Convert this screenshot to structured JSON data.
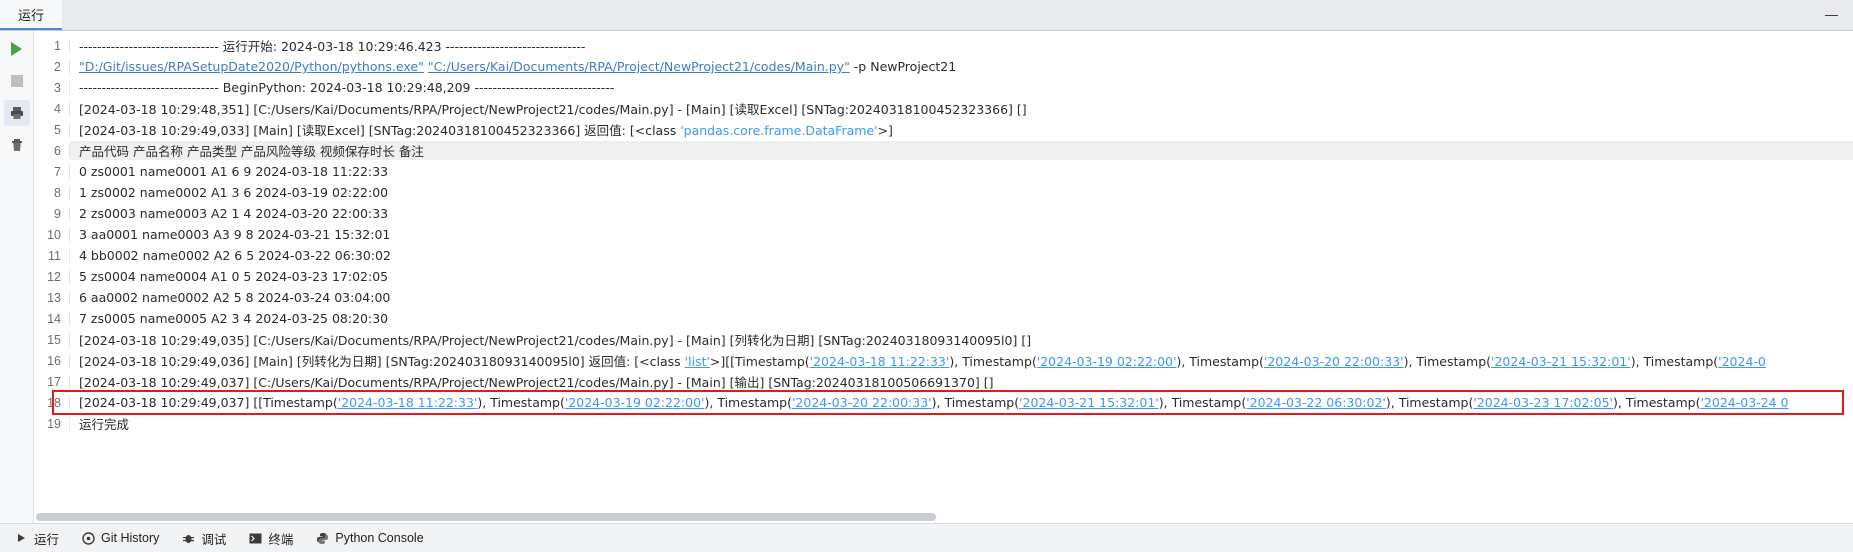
{
  "window": {
    "tab_label": "运行",
    "minimize_label": "—"
  },
  "side_toolbar": {
    "items": [
      {
        "name": "run-button",
        "icon": "play-icon",
        "tooltip": "运行"
      },
      {
        "name": "stop-button",
        "icon": "stop-icon",
        "tooltip": "停止"
      },
      {
        "name": "print-button",
        "icon": "printer-icon",
        "tooltip": "打印"
      },
      {
        "name": "clear-button",
        "icon": "trash-icon",
        "tooltip": "清空"
      }
    ]
  },
  "console": {
    "lines": [
      {
        "num": "1",
        "segments": [
          {
            "t": "------------------------------- 运行开始: 2024-03-18 10:29:46.423 -------------------------------",
            "s": "plain"
          }
        ]
      },
      {
        "num": "2",
        "segments": [
          {
            "t": "\"D:/Git/issues/RPASetupDate2020/Python/pythons.exe\"",
            "s": "link"
          },
          {
            "t": "    ",
            "s": "plain"
          },
          {
            "t": "\"C:/Users/Kai/Documents/RPA/Project/NewProject21/codes/Main.py\"",
            "s": "link"
          },
          {
            "t": "  -p  NewProject21",
            "s": "plain"
          }
        ]
      },
      {
        "num": "3",
        "segments": [
          {
            "t": "------------------------------- BeginPython: 2024-03-18 10:29:48,209 -------------------------------",
            "s": "plain"
          }
        ]
      },
      {
        "num": "4",
        "segments": [
          {
            "t": "[2024-03-18 10:29:48,351] [C:/Users/Kai/Documents/RPA/Project/NewProject21/codes/Main.py] - [Main] [读取Excel] [SNTag:20240318100452323366] []",
            "s": "plain"
          }
        ]
      },
      {
        "num": "5",
        "segments": [
          {
            "t": "[2024-03-18 10:29:49,033] [Main] [读取Excel] [SNTag:20240318100452323366]  返回值: [<class ",
            "s": "plain"
          },
          {
            "t": "'pandas.core.frame.DataFrame'",
            "s": "df"
          },
          {
            "t": ">]",
            "s": "plain"
          }
        ]
      },
      {
        "num": "6",
        "header": true,
        "segments": [
          {
            "t": "  产品代码    产品名称 产品类型 产品风险等级 视频保存时长              备注",
            "s": "plain"
          }
        ]
      },
      {
        "num": "7",
        "segments": [
          {
            "t": "0  zs0001  name0001   A1     6     9 2024-03-18 11:22:33",
            "s": "plain"
          }
        ]
      },
      {
        "num": "8",
        "segments": [
          {
            "t": "1  zs0002  name0002   A1     3     6 2024-03-19 02:22:00",
            "s": "plain"
          }
        ]
      },
      {
        "num": "9",
        "segments": [
          {
            "t": "2  zs0003  name0003   A2     1     4 2024-03-20 22:00:33",
            "s": "plain"
          }
        ]
      },
      {
        "num": "10",
        "segments": [
          {
            "t": "3  aa0001  name0003   A3     9      8 2024-03-21 15:32:01",
            "s": "plain"
          }
        ]
      },
      {
        "num": "11",
        "segments": [
          {
            "t": "4  bb0002  name0002   A2     6      5 2024-03-22 06:30:02",
            "s": "plain"
          }
        ]
      },
      {
        "num": "12",
        "segments": [
          {
            "t": "5  zs0004  name0004   A1     0      5 2024-03-23 17:02:05",
            "s": "plain"
          }
        ]
      },
      {
        "num": "13",
        "segments": [
          {
            "t": "6  aa0002  name0002   A2     5      8 2024-03-24 03:04:00",
            "s": "plain"
          }
        ]
      },
      {
        "num": "14",
        "segments": [
          {
            "t": "7  zs0005  name0005   A2     3      4 2024-03-25 08:20:30",
            "s": "plain"
          }
        ]
      },
      {
        "num": "15",
        "segments": [
          {
            "t": "[2024-03-18 10:29:49,035] [C:/Users/Kai/Documents/RPA/Project/NewProject21/codes/Main.py] - [Main] [列转化为日期] [SNTag:20240318093140095l0] []",
            "s": "plain"
          }
        ]
      },
      {
        "num": "16",
        "segments": [
          {
            "t": "[2024-03-18 10:29:49,036] [Main] [列转化为日期] [SNTag:20240318093140095l0]  返回值: [<class ",
            "s": "plain"
          },
          {
            "t": "'list'",
            "s": "ts"
          },
          {
            "t": ">][[Timestamp(",
            "s": "plain"
          },
          {
            "t": "'2024-03-18 11:22:33'",
            "s": "ts"
          },
          {
            "t": "), Timestamp(",
            "s": "plain"
          },
          {
            "t": "'2024-03-19 02:22:00'",
            "s": "ts"
          },
          {
            "t": "), Timestamp(",
            "s": "plain"
          },
          {
            "t": "'2024-03-20 22:00:33'",
            "s": "ts"
          },
          {
            "t": "), Timestamp(",
            "s": "plain"
          },
          {
            "t": "'2024-03-21 15:32:01'",
            "s": "ts"
          },
          {
            "t": "), Timestamp(",
            "s": "plain"
          },
          {
            "t": "'2024-0",
            "s": "ts"
          }
        ]
      },
      {
        "num": "17",
        "segments": [
          {
            "t": "[2024-03-18 10:29:49,037] [C:/Users/Kai/Documents/RPA/Project/NewProject21/codes/Main.py] - [Main] [输出] [SNTag:20240318100506691370] []",
            "s": "plain"
          }
        ]
      },
      {
        "num": "18",
        "highlighted": true,
        "segments": [
          {
            "t": "[2024-03-18 10:29:49,037] [[Timestamp(",
            "s": "plain"
          },
          {
            "t": "'2024-03-18 11:22:33'",
            "s": "ts"
          },
          {
            "t": "), Timestamp(",
            "s": "plain"
          },
          {
            "t": "'2024-03-19 02:22:00'",
            "s": "ts"
          },
          {
            "t": "), Timestamp(",
            "s": "plain"
          },
          {
            "t": "'2024-03-20 22:00:33'",
            "s": "ts"
          },
          {
            "t": "), Timestamp(",
            "s": "plain"
          },
          {
            "t": "'2024-03-21 15:32:01'",
            "s": "ts"
          },
          {
            "t": "), Timestamp(",
            "s": "plain"
          },
          {
            "t": "'2024-03-22 06:30:02'",
            "s": "ts"
          },
          {
            "t": "), Timestamp(",
            "s": "plain"
          },
          {
            "t": "'2024-03-23 17:02:05'",
            "s": "ts"
          },
          {
            "t": "), Timestamp(",
            "s": "plain"
          },
          {
            "t": "'2024-03-24 0",
            "s": "ts"
          }
        ]
      },
      {
        "num": "19",
        "segments": [
          {
            "t": "运行完成",
            "s": "plain"
          }
        ]
      }
    ]
  },
  "statusbar": {
    "items": [
      {
        "label": "运行",
        "icon": "play-small-icon"
      },
      {
        "label": "Git History",
        "icon": "git-icon"
      },
      {
        "label": "调试",
        "icon": "bug-icon"
      },
      {
        "label": "终端",
        "icon": "terminal-icon"
      },
      {
        "label": "Python Console",
        "icon": "python-icon"
      }
    ]
  },
  "colors": {
    "link": "#3b7ec4",
    "timestamp": "#3b9bf0",
    "highlight_border": "#e41a1a",
    "tab_underline": "#4a88c7",
    "run_green": "#4a9e4a"
  }
}
